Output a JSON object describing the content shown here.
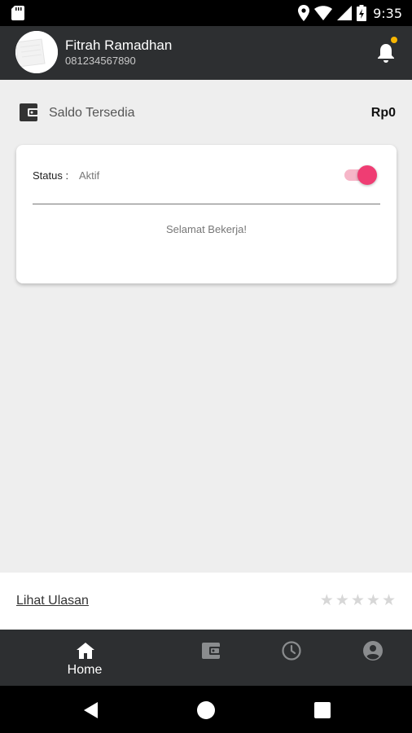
{
  "status_bar": {
    "time": "9:35",
    "icons": [
      "sd-card-icon",
      "location-icon",
      "wifi-icon",
      "signal-icon",
      "battery-icon"
    ]
  },
  "header": {
    "user_name": "Fitrah Ramadhan",
    "phone": "081234567890",
    "notification_dot_color": "#f7b500"
  },
  "saldo": {
    "label": "Saldo Tersedia",
    "amount": "Rp0"
  },
  "status_card": {
    "status_label": "Status :",
    "status_value": "Aktif",
    "toggle_on": true,
    "greeting": "Selamat Bekerja!"
  },
  "review": {
    "link_label": "Lihat Ulasan",
    "rating": 0,
    "max_rating": 5
  },
  "bottom_nav": {
    "items": [
      {
        "id": "home",
        "label": "Home",
        "icon": "home-icon",
        "active": true
      },
      {
        "id": "wallet",
        "label": "",
        "icon": "wallet-icon",
        "active": false
      },
      {
        "id": "history",
        "label": "",
        "icon": "clock-icon",
        "active": false
      },
      {
        "id": "account",
        "label": "",
        "icon": "account-icon",
        "active": false
      }
    ]
  },
  "colors": {
    "header_bg": "#2d2f31",
    "accent": "#ef3d73",
    "page_bg": "#eeeeee"
  }
}
